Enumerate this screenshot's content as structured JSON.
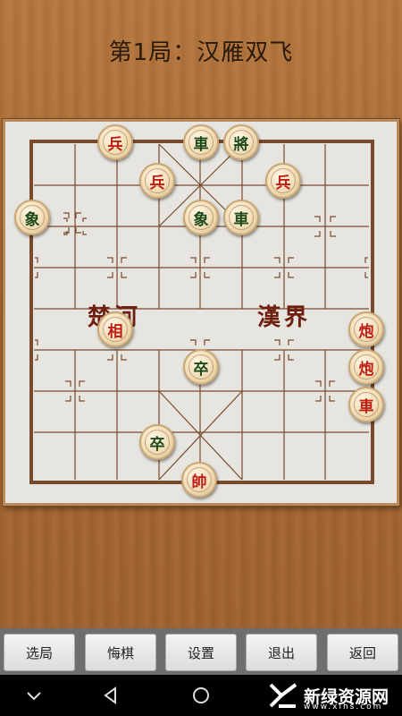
{
  "header": {
    "title": "第1局：汉雁双飞"
  },
  "board": {
    "river_left": "楚河",
    "river_right": "漢界",
    "pieces": [
      {
        "name": "piece-red-bing-1",
        "label": "兵",
        "color": "red"
      },
      {
        "name": "piece-black-che-1",
        "label": "車",
        "color": "black"
      },
      {
        "name": "piece-black-jiang",
        "label": "將",
        "color": "black"
      },
      {
        "name": "piece-red-bing-2",
        "label": "兵",
        "color": "red"
      },
      {
        "name": "piece-red-bing-3",
        "label": "兵",
        "color": "red"
      },
      {
        "name": "piece-black-xiang-1",
        "label": "象",
        "color": "black"
      },
      {
        "name": "piece-black-xiang-2",
        "label": "象",
        "color": "black"
      },
      {
        "name": "piece-black-che-2",
        "label": "車",
        "color": "black"
      },
      {
        "name": "piece-red-xiang",
        "label": "相",
        "color": "red"
      },
      {
        "name": "piece-red-pao-1",
        "label": "炮",
        "color": "red"
      },
      {
        "name": "piece-black-zu-1",
        "label": "卒",
        "color": "black"
      },
      {
        "name": "piece-red-pao-2",
        "label": "炮",
        "color": "red"
      },
      {
        "name": "piece-red-che",
        "label": "車",
        "color": "red"
      },
      {
        "name": "piece-black-zu-2",
        "label": "卒",
        "color": "black"
      },
      {
        "name": "piece-red-shuai",
        "label": "帥",
        "color": "red"
      }
    ]
  },
  "toolbar": {
    "select_level": "选局",
    "undo": "悔棋",
    "settings": "设置",
    "exit": "退出",
    "back": "返回"
  },
  "watermark": {
    "name": "新绿资源网",
    "url": "www.xlhs.com"
  },
  "colors": {
    "red_piece": "#c01d12",
    "black_piece": "#1d4a17",
    "board": "#e7e5df",
    "lines": "#7a4a2e"
  }
}
